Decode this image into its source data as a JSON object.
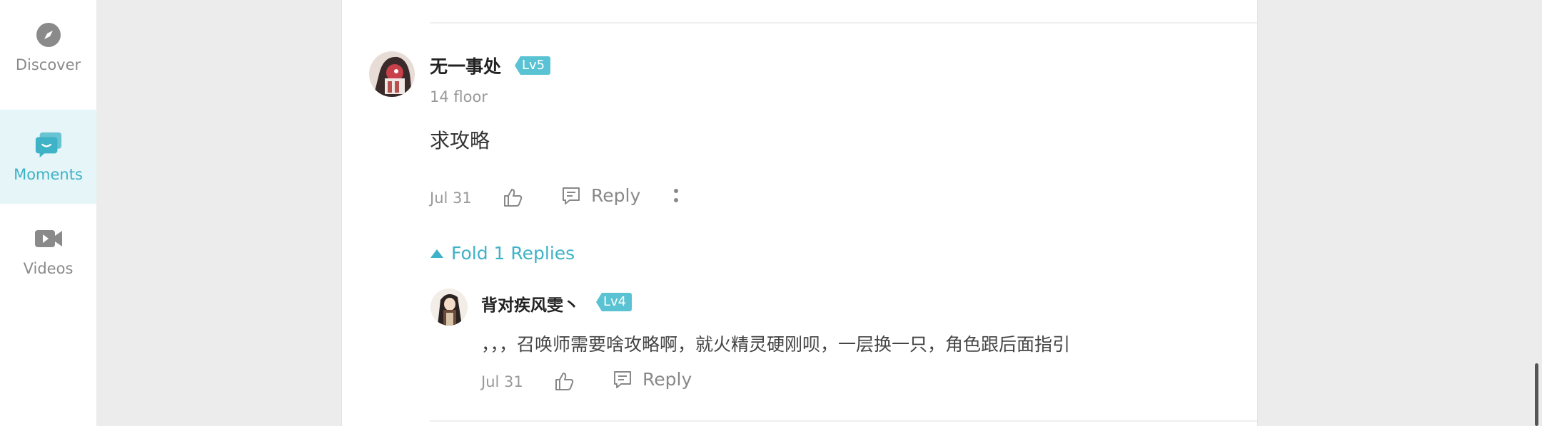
{
  "sidebar": {
    "items": [
      {
        "label": "Discover",
        "icon": "compass-icon",
        "active": false
      },
      {
        "label": "Moments",
        "icon": "chat-bubbles-icon",
        "active": true
      },
      {
        "label": "Videos",
        "icon": "video-camera-icon",
        "active": false
      }
    ]
  },
  "comment": {
    "author": "无一事处",
    "level": "Lv5",
    "floor": "14 floor",
    "text": "求攻略",
    "date": "Jul 31",
    "reply_label": "Reply"
  },
  "fold_label": "Fold 1 Replies",
  "reply": {
    "author": "背对疾风雯丶",
    "level": "Lv4",
    "text": "，，，召唤师需要啥攻略啊，就火精灵硬刚呗，一层换一只，角色跟后面指引",
    "date": "Jul 31",
    "reply_label": "Reply"
  },
  "colors": {
    "accent": "#3eb2c6",
    "badge": "#59c3d3",
    "active_bg": "#e6f5f8"
  }
}
